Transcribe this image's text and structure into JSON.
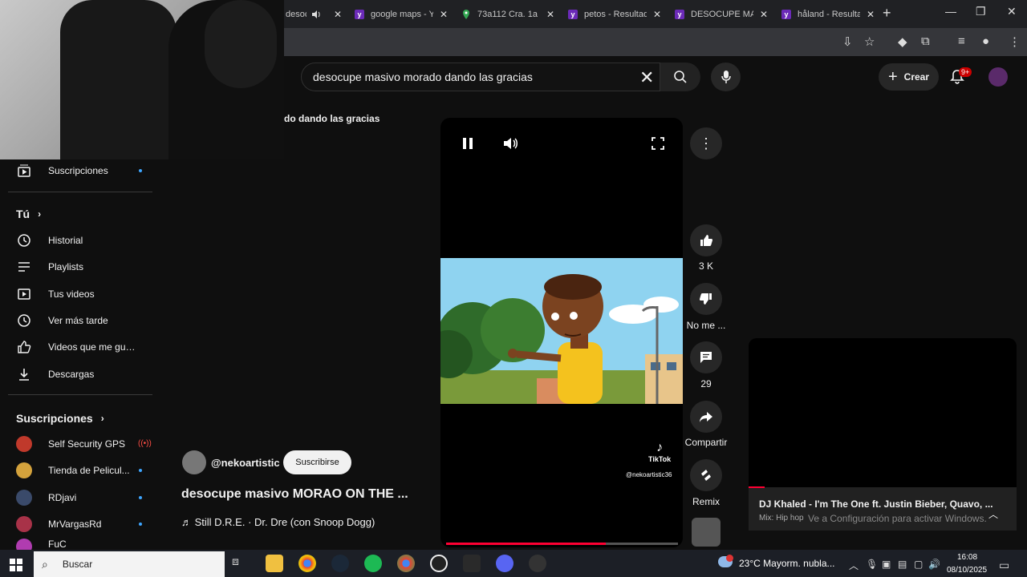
{
  "browser": {
    "tabs": [
      {
        "label": "desocu",
        "icon": "speaker-icon",
        "active": true
      },
      {
        "label": "google maps - Y",
        "icon": "yahoo-icon"
      },
      {
        "label": "73a112 Cra. 1a 1",
        "icon": "maps-pin-icon"
      },
      {
        "label": "petos - Resultad",
        "icon": "yahoo-icon"
      },
      {
        "label": "DESOCUPE MAS",
        "icon": "yahoo-icon"
      },
      {
        "label": "håland - Resulta",
        "icon": "yahoo-icon"
      }
    ],
    "new_tab": "+"
  },
  "masthead": {
    "search_value": "desocupe masivo morado dando las gracias",
    "create_label": "Crear",
    "notifications_badge": "9+"
  },
  "shorts_header": "do dando las gracias",
  "sidebar": {
    "top_item": "Suscripciones",
    "you_heading": "Tú",
    "you_items": [
      {
        "label": "Historial",
        "icon": "history-icon"
      },
      {
        "label": "Playlists",
        "icon": "playlist-icon"
      },
      {
        "label": "Tus videos",
        "icon": "your-videos-icon"
      },
      {
        "label": "Ver más tarde",
        "icon": "watch-later-icon"
      },
      {
        "label": "Videos que me gus...",
        "icon": "liked-icon"
      },
      {
        "label": "Descargas",
        "icon": "download-icon"
      }
    ],
    "subs_heading": "Suscripciones",
    "subs": [
      {
        "label": "Self Security GPS",
        "live": true
      },
      {
        "label": "Tienda de Pelicul..."
      },
      {
        "label": "RDjavi"
      },
      {
        "label": "MrVargasRd"
      },
      {
        "label": "FuC"
      }
    ]
  },
  "player": {
    "watermark_brand": "TikTok",
    "watermark_handle": "@nekoartistic36",
    "progress": 0.69
  },
  "actions": {
    "likes": "3 K",
    "dislike": "No me ...",
    "comments": "29",
    "share": "Compartir",
    "remix": "Remix"
  },
  "channel": {
    "handle": "@nekoartistic",
    "subscribe": "Suscribirse"
  },
  "video": {
    "title": "desocupe masivo MORAO ON THE ...",
    "music": "♬ Still D.R.E. · Dr. Dre (con Snoop Dogg)"
  },
  "mini_player": {
    "title": "DJ Khaled - I'm The One ft. Justin Bieber, Quavo, ...",
    "subtitle": "Mix: Hip hop",
    "activation_notice": "Ve a Configuración para activar Windows."
  },
  "taskbar": {
    "search_placeholder": "Buscar",
    "weather": "23°C  Mayorm. nubla...",
    "time": "16:08",
    "date": "08/10/2025"
  },
  "colors": {
    "accent": "#ff0033",
    "badge": "#cc0000",
    "subscribe_bg": "#f1f1f1",
    "yahoo": "#6b2ab8"
  }
}
